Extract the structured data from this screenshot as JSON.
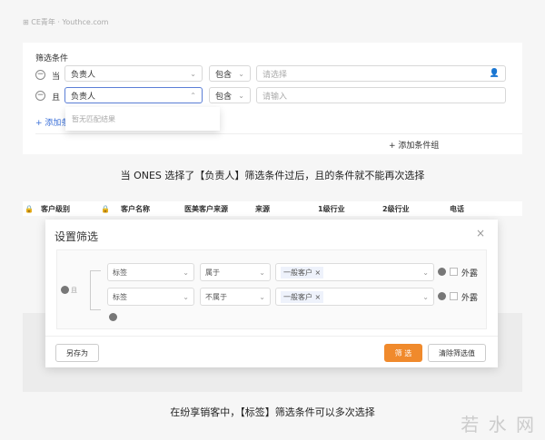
{
  "source": "⊞ CE青年 · Youthce.com",
  "panel1": {
    "title": "筛选条件",
    "rows": [
      {
        "conj": "当",
        "field": "负责人",
        "op": "包含",
        "value_placeholder": "请选择"
      },
      {
        "conj": "且",
        "field": "负责人",
        "op": "包含",
        "value_placeholder": "请输入"
      }
    ],
    "dropdown_empty": "暂无匹配结果",
    "add_condition": "添加条",
    "add_group": "添加条件组"
  },
  "caption1": "当 ONES 选择了【负责人】筛选条件过后，且的条件就不能再次选择",
  "table_headers": [
    "客户级别",
    "客户名称",
    "医美客户来源",
    "来源",
    "1级行业",
    "2级行业",
    "电话"
  ],
  "modal": {
    "title": "设置筛选",
    "conj": "且",
    "rows": [
      {
        "field": "标签",
        "op": "属于",
        "value": "一般客户",
        "exposed": "外露"
      },
      {
        "field": "标签",
        "op": "不属于",
        "value": "一般客户",
        "exposed": "外露"
      }
    ],
    "save_as": "另存为",
    "filter": "筛 选",
    "clear": "清除筛选值"
  },
  "caption2": "在纷享销客中，【标签】筛选条件可以多次选择",
  "watermark": "若 水 网",
  "colors": {
    "accent": "#f08a2c",
    "link": "#3a6fd8"
  }
}
